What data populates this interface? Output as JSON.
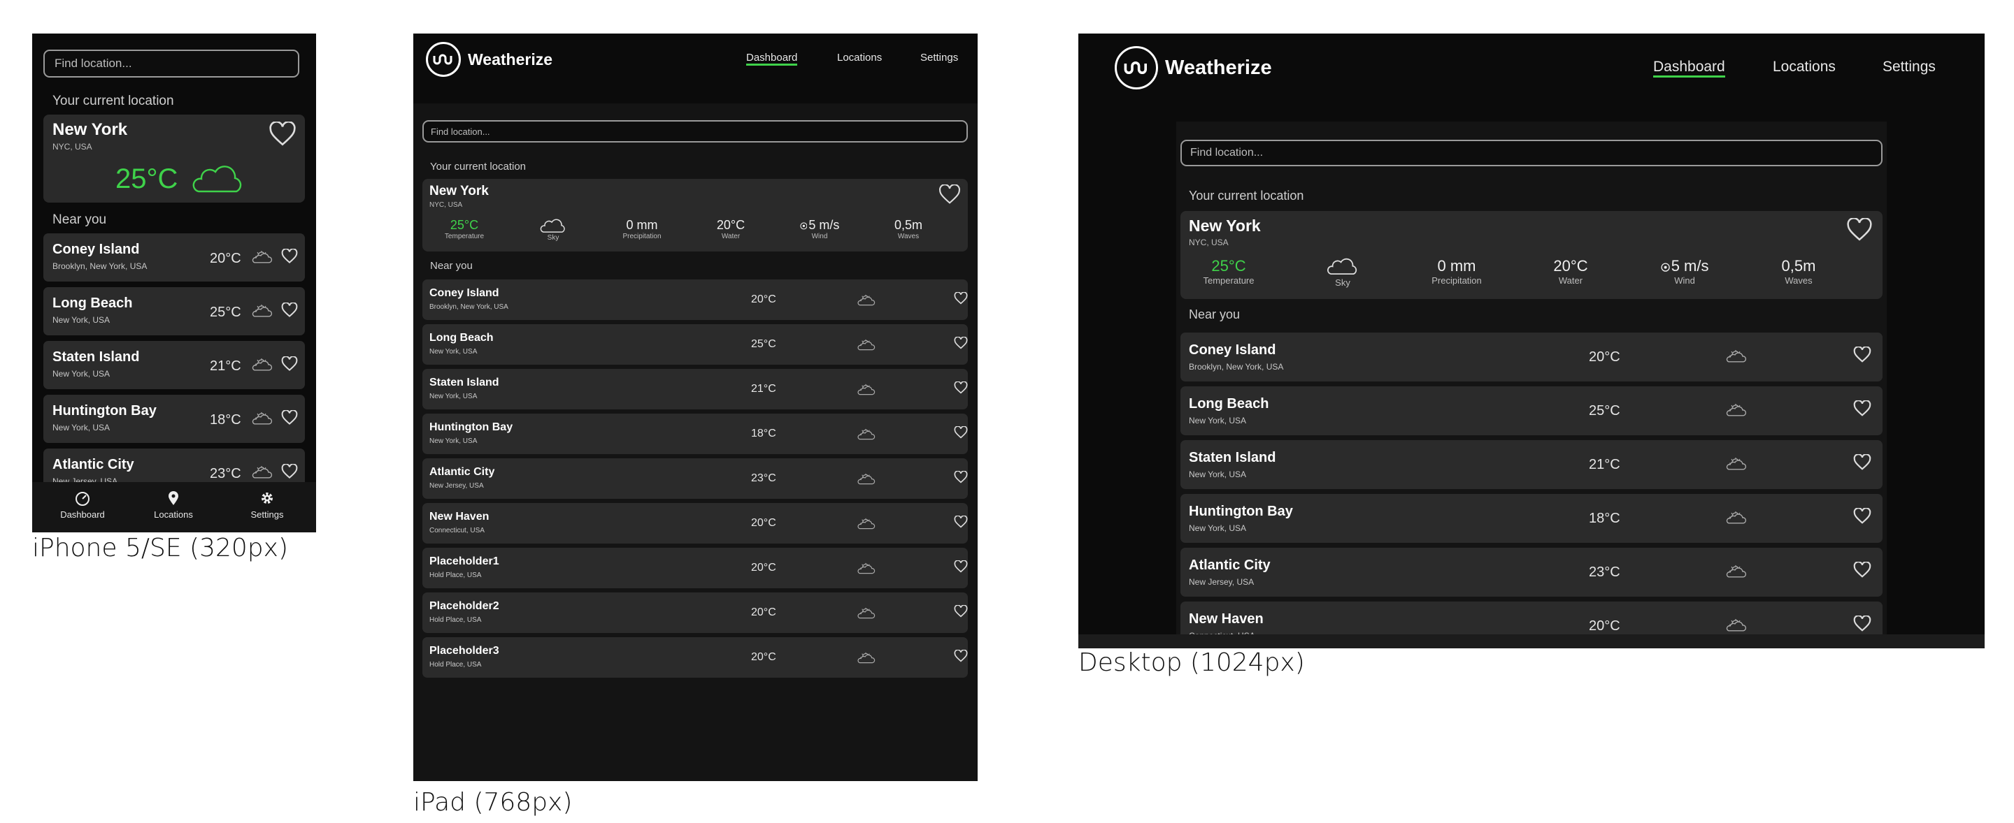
{
  "app": {
    "name": "Weatherize"
  },
  "captions": {
    "phone": "iPhone 5/SE (320px)",
    "tablet": "iPad (768px)",
    "desktop": "Desktop (1024px)"
  },
  "nav": {
    "dashboard": "Dashboard",
    "locations": "Locations",
    "settings": "Settings"
  },
  "search": {
    "placeholder": "Find location..."
  },
  "current": {
    "section_label": "Your current location",
    "city": "New York",
    "region": "NYC, USA",
    "temperature": "25°C",
    "phone_temperature": "25°C",
    "stats": [
      {
        "value": "25°C",
        "label": "Temperature"
      },
      {
        "value": "",
        "label": "Sky"
      },
      {
        "value": "0 mm",
        "label": "Precipitation"
      },
      {
        "value": "20°C",
        "label": "Water"
      },
      {
        "value": "5 m/s",
        "label": "Wind"
      },
      {
        "value": "0,5m",
        "label": "Waves"
      }
    ]
  },
  "near_label": "Near you",
  "locations": [
    {
      "name": "Coney Island",
      "region": "Brooklyn, New York, USA",
      "temp": "20°C"
    },
    {
      "name": "Long Beach",
      "region": "New York, USA",
      "temp": "25°C"
    },
    {
      "name": "Staten Island",
      "region": "New York, USA",
      "temp": "21°C"
    },
    {
      "name": "Huntington Bay",
      "region": "New York, USA",
      "temp": "18°C"
    },
    {
      "name": "Atlantic City",
      "region": "New Jersey, USA",
      "temp": "23°C"
    },
    {
      "name": "New Haven",
      "region": "Connecticut, USA",
      "temp": "20°C"
    },
    {
      "name": "Placeholder1",
      "region": "Hold Place, USA",
      "temp": "20°C"
    },
    {
      "name": "Placeholder2",
      "region": "Hold Place, USA",
      "temp": "20°C"
    },
    {
      "name": "Placeholder3",
      "region": "Hold Place, USA",
      "temp": "20°C"
    }
  ],
  "colors": {
    "accent": "#3fd24a",
    "background": "#0b0b0b",
    "card": "#2a2a2a"
  },
  "icons": {
    "sky": "cloud-icon",
    "row_weather": "partly-cloudy-icon",
    "favorite": "heart-icon",
    "wind": "compass-icon"
  }
}
